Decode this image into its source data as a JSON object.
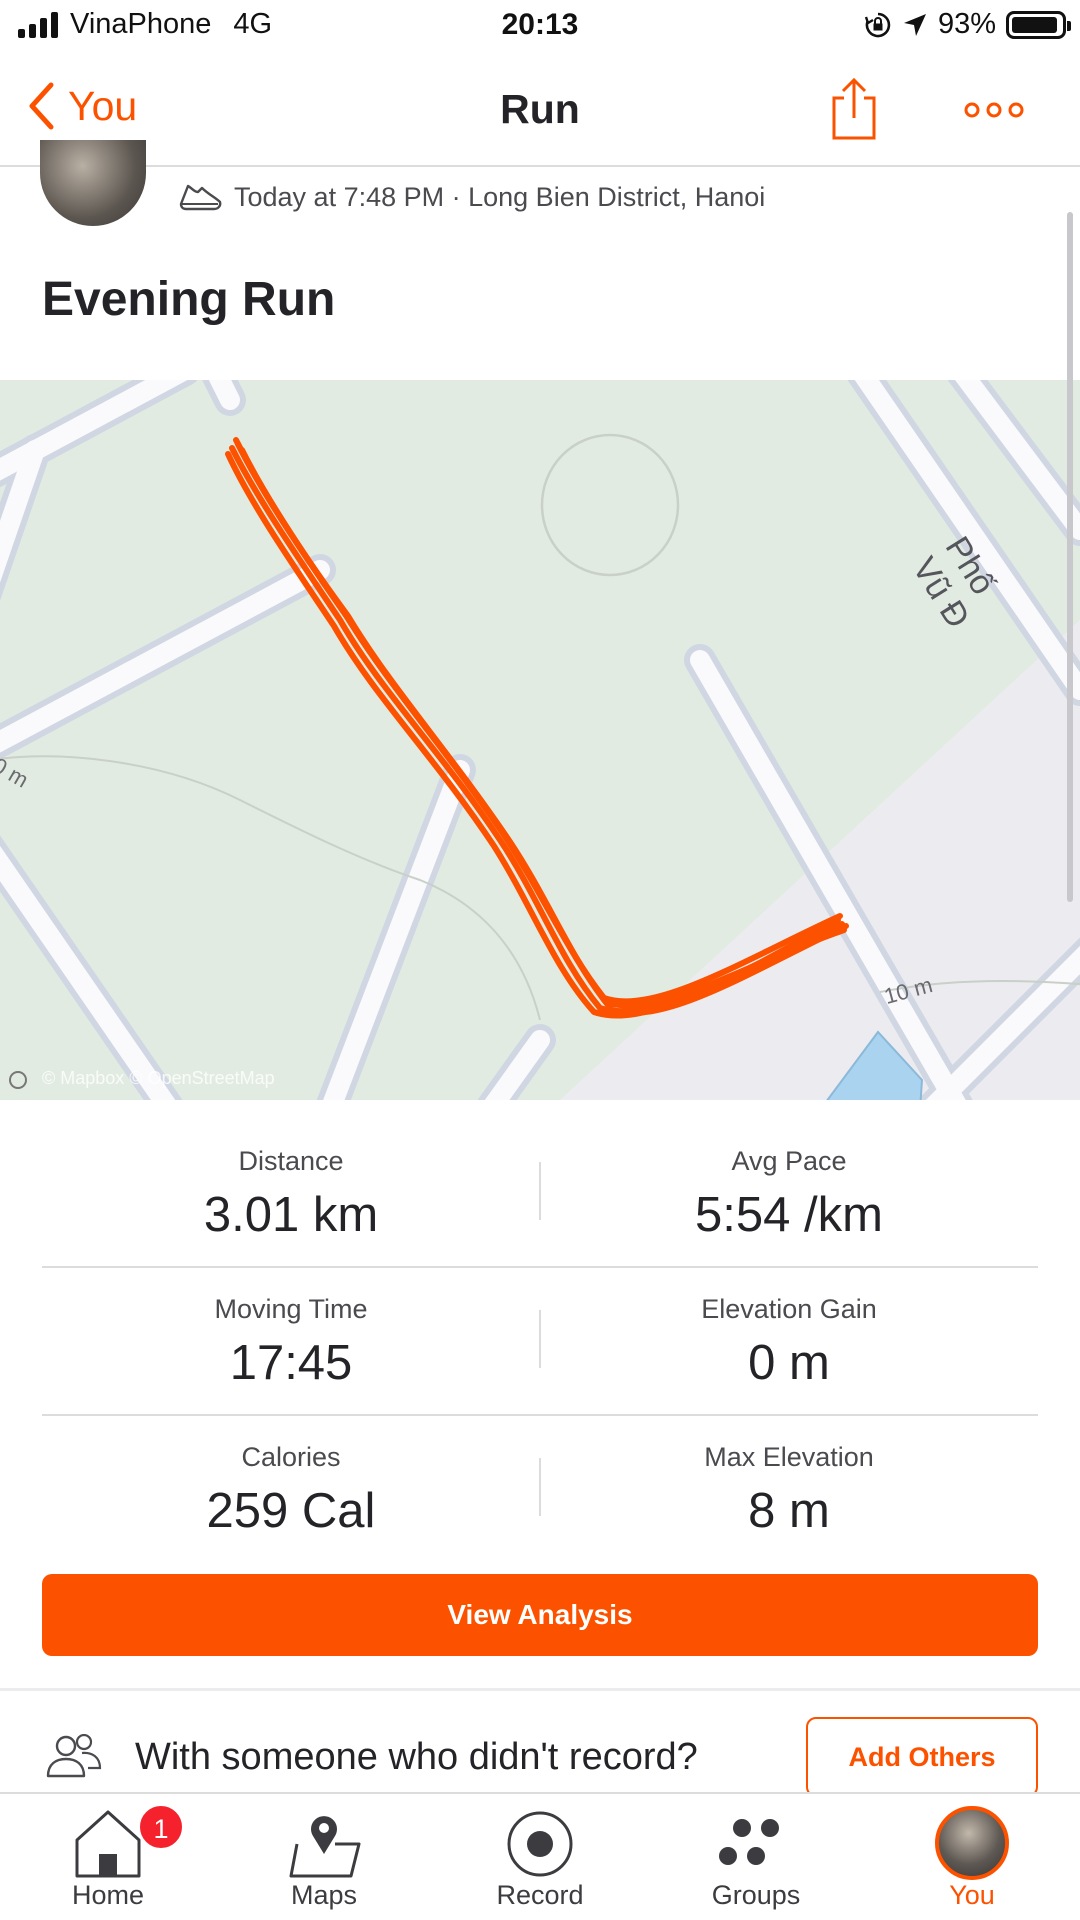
{
  "status_bar": {
    "carrier": "VinaPhone",
    "network": "4G",
    "time": "20:13",
    "battery_text": "93%",
    "battery_level": 0.93
  },
  "nav": {
    "back_label": "You",
    "title": "Run",
    "back_icon": "chevron-left-icon",
    "share_icon": "share-icon",
    "more_icon": "more-dots-icon"
  },
  "activity": {
    "meta": "Today at 7:48 PM · Long Bien District, Hanoi",
    "title": "Evening Run"
  },
  "map": {
    "street_label": "Phố Vũ Đ",
    "scale_label_right": "10 m",
    "scale_label_left": "0 m",
    "attribution": "© Mapbox © OpenStreetMap",
    "route_color": "#fc5200"
  },
  "stats": [
    {
      "left": {
        "label": "Distance",
        "value": "3.01 km"
      },
      "right": {
        "label": "Avg Pace",
        "value": "5:54 /km"
      }
    },
    {
      "left": {
        "label": "Moving Time",
        "value": "17:45"
      },
      "right": {
        "label": "Elevation Gain",
        "value": "0 m"
      }
    },
    {
      "left": {
        "label": "Calories",
        "value": "259 Cal"
      },
      "right": {
        "label": "Max Elevation",
        "value": "8 m"
      }
    }
  ],
  "view_analysis_label": "View Analysis",
  "others": {
    "text": "With someone who didn't record?",
    "button_label": "Add Others"
  },
  "tabs": [
    {
      "label": "Home",
      "icon": "home-icon",
      "badge": "1"
    },
    {
      "label": "Maps",
      "icon": "map-pin-icon"
    },
    {
      "label": "Record",
      "icon": "record-icon"
    },
    {
      "label": "Groups",
      "icon": "groups-icon"
    },
    {
      "label": "You",
      "icon": "profile-avatar",
      "active": true
    }
  ],
  "colors": {
    "accent": "#fc5200",
    "badge": "#f5222d"
  }
}
